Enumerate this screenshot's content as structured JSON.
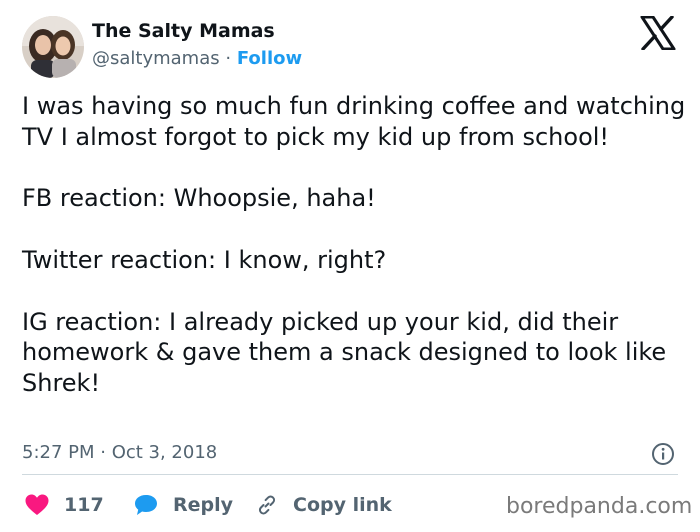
{
  "author": {
    "name": "The Salty Mamas",
    "handle": "@saltymamas",
    "separator": "·",
    "follow_label": "Follow"
  },
  "tweet": {
    "paragraphs": [
      "I was having so much fun drinking coffee and watching TV I almost forgot to pick my kid up from school!",
      "FB reaction: Whoopsie, haha!",
      "Twitter reaction: I know, right?",
      "IG reaction: I already picked up your kid, did their homework & gave them a snack designed to look like Shrek!"
    ],
    "timestamp": "5:27 PM · Oct 3, 2018"
  },
  "actions": {
    "like_count": "117",
    "reply_label": "Reply",
    "copy_label": "Copy link"
  },
  "watermark": "boredpanda.com",
  "colors": {
    "accent": "#1d9bf0",
    "like": "#f91880",
    "muted": "#536471"
  },
  "icons": {
    "logo": "x-logo-icon",
    "info": "info-icon",
    "like": "heart-icon",
    "reply": "speech-bubble-icon",
    "copy": "link-icon"
  }
}
